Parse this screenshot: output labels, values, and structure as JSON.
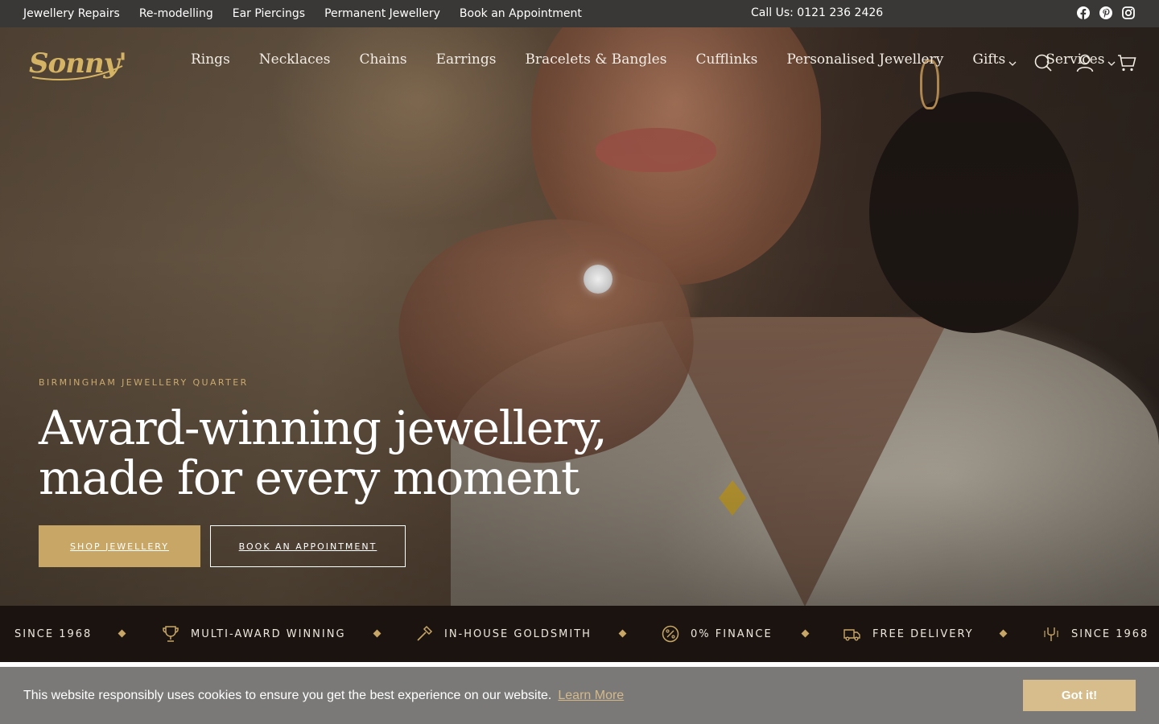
{
  "topbar": {
    "links": [
      "Jewellery Repairs",
      "Re-modelling",
      "Ear Piercings",
      "Permanent Jewellery",
      "Book an Appointment"
    ],
    "phone": "Call Us: 0121 236 2426",
    "social_icons": [
      "facebook-icon",
      "pinterest-icon",
      "instagram-icon"
    ]
  },
  "brand": {
    "logo_text": "Sonny's",
    "gold": "#c8a766",
    "dark": "#1a1310"
  },
  "nav": {
    "items": [
      {
        "label": "Rings"
      },
      {
        "label": "Necklaces"
      },
      {
        "label": "Chains"
      },
      {
        "label": "Earrings"
      },
      {
        "label": "Bracelets & Bangles"
      },
      {
        "label": "Cufflinks"
      },
      {
        "label": "Personalised Jewellery"
      },
      {
        "label": "Gifts",
        "dropdown": true
      },
      {
        "label": "Services",
        "dropdown": true
      }
    ],
    "icons": [
      "search-icon",
      "account-icon",
      "cart-icon"
    ]
  },
  "hero": {
    "eyebrow": "BIRMINGHAM JEWELLERY QUARTER",
    "headline": "Award-winning jewellery, made for every moment",
    "primary_cta": "SHOP JEWELLERY",
    "secondary_cta": "BOOK AN APPOINTMENT"
  },
  "usp": {
    "items": [
      {
        "label": "SINCE 1968",
        "icon": "tuning-fork-icon"
      },
      {
        "label": "MULTI-AWARD WINNING",
        "icon": "trophy-icon"
      },
      {
        "label": "IN-HOUSE GOLDSMITH",
        "icon": "hammer-icon"
      },
      {
        "label": "0% FINANCE",
        "icon": "percent-icon"
      },
      {
        "label": "FREE DELIVERY",
        "icon": "truck-icon"
      },
      {
        "label": "SINCE 1968",
        "icon": "tuning-fork-icon"
      }
    ]
  },
  "cookie": {
    "message": "This website responsibly uses cookies to ensure you get the best experience on our website.",
    "learn_more": "Learn More",
    "accept": "Got it!"
  }
}
